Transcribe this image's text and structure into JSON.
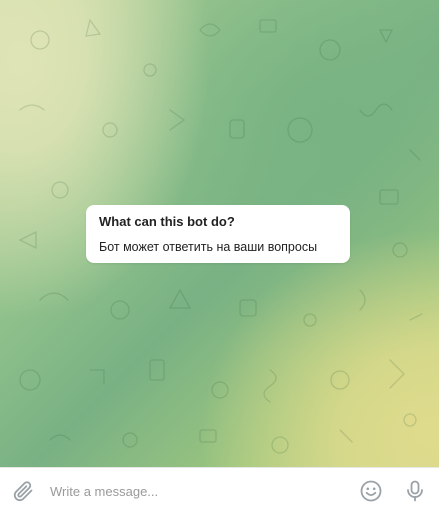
{
  "bot_info": {
    "title": "What can this bot do?",
    "description": "Бот может ответить на ваши вопросы"
  },
  "composer": {
    "placeholder": "Write a message...",
    "value": "",
    "attach_icon": "paperclip-icon",
    "emoji_icon": "smiley-icon",
    "voice_icon": "microphone-icon"
  },
  "colors": {
    "wallpaper_green": "#79b184",
    "wallpaper_cream": "#dfe4b6",
    "wallpaper_yellow": "#dfdb8c",
    "icon_gray": "#9aa2a8",
    "bubble": "#ffffff"
  }
}
